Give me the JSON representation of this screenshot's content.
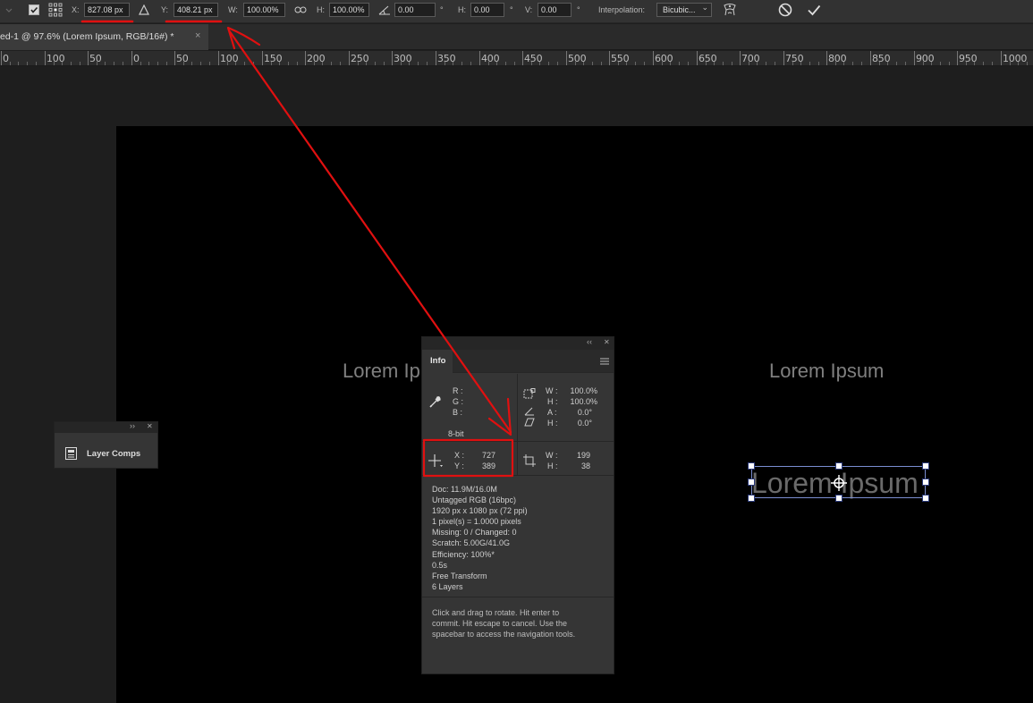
{
  "options_bar": {
    "x_label": "X:",
    "x_value": "827.08 px",
    "y_label": "Y:",
    "y_value": "408.21 px",
    "w_label": "W:",
    "w_value": "100.00%",
    "h_label": "H:",
    "h_value": "100.00%",
    "angle_value": "0.00",
    "deg": "°",
    "hskew_label": "H:",
    "hskew_value": "0.00",
    "vskew_label": "V:",
    "vskew_value": "0.00",
    "interpolation_label": "Interpolation:",
    "interpolation_value": "Bicubic...",
    "chevron": "⌄",
    "cancel_icon": "cancel-icon",
    "commit_icon": "check-icon"
  },
  "tab": {
    "title": "ed-1 @ 97.6% (Lorem Ipsum, RGB/16#) *",
    "close": "×"
  },
  "ruler": {
    "labels": [
      "0",
      "100",
      "50",
      "0",
      "50",
      "100",
      "150",
      "200",
      "250",
      "300",
      "350",
      "400",
      "450",
      "500",
      "550",
      "600",
      "650",
      "700",
      "750",
      "800",
      "850",
      "900",
      "950",
      "1000"
    ]
  },
  "canvas": {
    "text_left": "Lorem Ip",
    "text_right": "Lorem Ipsum",
    "text_selected": "Lorem Ipsum"
  },
  "info_panel": {
    "collapse": "‹‹",
    "close": "✕",
    "tab_label": "Info",
    "menu_icon": "panel-menu-icon",
    "r_label": "R :",
    "g_label": "G :",
    "b_label": "B :",
    "bit_depth": "8-bit",
    "w_label": "W :",
    "w_pct": "100.0%",
    "h_label": "H :",
    "h_pct": "100.0%",
    "a_label": "A :",
    "a_value": "0.0°",
    "h2_label": "H :",
    "h2_value": "0.0°",
    "x_label": "X :",
    "x_value": "727",
    "y_label": "Y :",
    "y_value": "389",
    "sel_w_label": "W :",
    "sel_w_value": "199",
    "sel_h_label": "H :",
    "sel_h_value": "38",
    "doc_lines": [
      "Doc: 11.9M/16.0M",
      "Untagged RGB (16bpc)",
      "1920 px x 1080 px (72 ppi)",
      "1 pixel(s) = 1.0000 pixels",
      "Missing: 0 / Changed: 0",
      "Scratch: 5.00G/41.0G",
      "Efficiency: 100%*",
      "0.5s",
      "Free Transform",
      "6 Layers"
    ],
    "hint_lines": [
      "Click and drag to rotate. Hit enter to",
      "commit. Hit escape to cancel. Use the",
      "spacebar to access the navigation tools."
    ]
  },
  "layer_comps_panel": {
    "expand": "››",
    "close": "✕",
    "label": "Layer Comps"
  },
  "colors": {
    "annotation": "#e01010",
    "panel_bg": "#353535",
    "canvas_bg": "#000000",
    "transform_box": "#7a8dd0"
  }
}
